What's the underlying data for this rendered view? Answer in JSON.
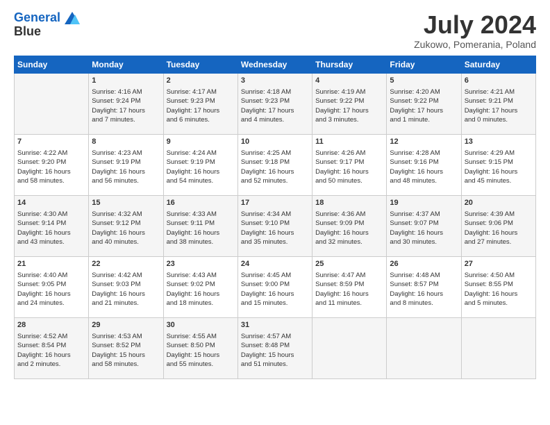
{
  "header": {
    "logo_line1": "General",
    "logo_line2": "Blue",
    "month_title": "July 2024",
    "subtitle": "Zukowo, Pomerania, Poland"
  },
  "days_of_week": [
    "Sunday",
    "Monday",
    "Tuesday",
    "Wednesday",
    "Thursday",
    "Friday",
    "Saturday"
  ],
  "weeks": [
    [
      {
        "day": "",
        "content": ""
      },
      {
        "day": "1",
        "content": "Sunrise: 4:16 AM\nSunset: 9:24 PM\nDaylight: 17 hours\nand 7 minutes."
      },
      {
        "day": "2",
        "content": "Sunrise: 4:17 AM\nSunset: 9:23 PM\nDaylight: 17 hours\nand 6 minutes."
      },
      {
        "day": "3",
        "content": "Sunrise: 4:18 AM\nSunset: 9:23 PM\nDaylight: 17 hours\nand 4 minutes."
      },
      {
        "day": "4",
        "content": "Sunrise: 4:19 AM\nSunset: 9:22 PM\nDaylight: 17 hours\nand 3 minutes."
      },
      {
        "day": "5",
        "content": "Sunrise: 4:20 AM\nSunset: 9:22 PM\nDaylight: 17 hours\nand 1 minute."
      },
      {
        "day": "6",
        "content": "Sunrise: 4:21 AM\nSunset: 9:21 PM\nDaylight: 17 hours\nand 0 minutes."
      }
    ],
    [
      {
        "day": "7",
        "content": "Sunrise: 4:22 AM\nSunset: 9:20 PM\nDaylight: 16 hours\nand 58 minutes."
      },
      {
        "day": "8",
        "content": "Sunrise: 4:23 AM\nSunset: 9:19 PM\nDaylight: 16 hours\nand 56 minutes."
      },
      {
        "day": "9",
        "content": "Sunrise: 4:24 AM\nSunset: 9:19 PM\nDaylight: 16 hours\nand 54 minutes."
      },
      {
        "day": "10",
        "content": "Sunrise: 4:25 AM\nSunset: 9:18 PM\nDaylight: 16 hours\nand 52 minutes."
      },
      {
        "day": "11",
        "content": "Sunrise: 4:26 AM\nSunset: 9:17 PM\nDaylight: 16 hours\nand 50 minutes."
      },
      {
        "day": "12",
        "content": "Sunrise: 4:28 AM\nSunset: 9:16 PM\nDaylight: 16 hours\nand 48 minutes."
      },
      {
        "day": "13",
        "content": "Sunrise: 4:29 AM\nSunset: 9:15 PM\nDaylight: 16 hours\nand 45 minutes."
      }
    ],
    [
      {
        "day": "14",
        "content": "Sunrise: 4:30 AM\nSunset: 9:14 PM\nDaylight: 16 hours\nand 43 minutes."
      },
      {
        "day": "15",
        "content": "Sunrise: 4:32 AM\nSunset: 9:12 PM\nDaylight: 16 hours\nand 40 minutes."
      },
      {
        "day": "16",
        "content": "Sunrise: 4:33 AM\nSunset: 9:11 PM\nDaylight: 16 hours\nand 38 minutes."
      },
      {
        "day": "17",
        "content": "Sunrise: 4:34 AM\nSunset: 9:10 PM\nDaylight: 16 hours\nand 35 minutes."
      },
      {
        "day": "18",
        "content": "Sunrise: 4:36 AM\nSunset: 9:09 PM\nDaylight: 16 hours\nand 32 minutes."
      },
      {
        "day": "19",
        "content": "Sunrise: 4:37 AM\nSunset: 9:07 PM\nDaylight: 16 hours\nand 30 minutes."
      },
      {
        "day": "20",
        "content": "Sunrise: 4:39 AM\nSunset: 9:06 PM\nDaylight: 16 hours\nand 27 minutes."
      }
    ],
    [
      {
        "day": "21",
        "content": "Sunrise: 4:40 AM\nSunset: 9:05 PM\nDaylight: 16 hours\nand 24 minutes."
      },
      {
        "day": "22",
        "content": "Sunrise: 4:42 AM\nSunset: 9:03 PM\nDaylight: 16 hours\nand 21 minutes."
      },
      {
        "day": "23",
        "content": "Sunrise: 4:43 AM\nSunset: 9:02 PM\nDaylight: 16 hours\nand 18 minutes."
      },
      {
        "day": "24",
        "content": "Sunrise: 4:45 AM\nSunset: 9:00 PM\nDaylight: 16 hours\nand 15 minutes."
      },
      {
        "day": "25",
        "content": "Sunrise: 4:47 AM\nSunset: 8:59 PM\nDaylight: 16 hours\nand 11 minutes."
      },
      {
        "day": "26",
        "content": "Sunrise: 4:48 AM\nSunset: 8:57 PM\nDaylight: 16 hours\nand 8 minutes."
      },
      {
        "day": "27",
        "content": "Sunrise: 4:50 AM\nSunset: 8:55 PM\nDaylight: 16 hours\nand 5 minutes."
      }
    ],
    [
      {
        "day": "28",
        "content": "Sunrise: 4:52 AM\nSunset: 8:54 PM\nDaylight: 16 hours\nand 2 minutes."
      },
      {
        "day": "29",
        "content": "Sunrise: 4:53 AM\nSunset: 8:52 PM\nDaylight: 15 hours\nand 58 minutes."
      },
      {
        "day": "30",
        "content": "Sunrise: 4:55 AM\nSunset: 8:50 PM\nDaylight: 15 hours\nand 55 minutes."
      },
      {
        "day": "31",
        "content": "Sunrise: 4:57 AM\nSunset: 8:48 PM\nDaylight: 15 hours\nand 51 minutes."
      },
      {
        "day": "",
        "content": ""
      },
      {
        "day": "",
        "content": ""
      },
      {
        "day": "",
        "content": ""
      }
    ]
  ]
}
